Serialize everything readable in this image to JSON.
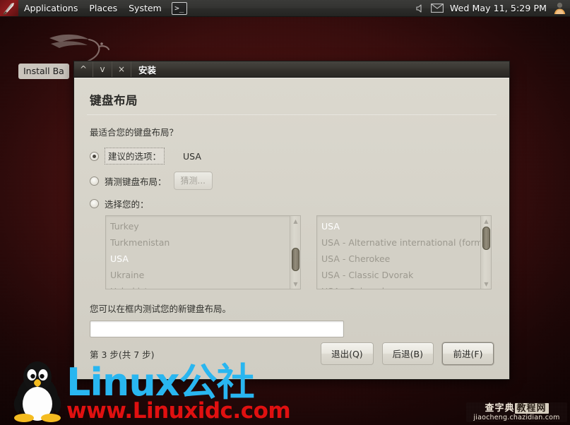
{
  "panel": {
    "logo_icon": "backtrack-sword-icon",
    "menus": [
      "Applications",
      "Places",
      "System"
    ],
    "terminal_icon": "terminal-icon",
    "terminal_glyph": ">_",
    "volume_icon": "volume-icon",
    "mail_icon": "mail-icon",
    "clock": "Wed May 11,  5:29 PM",
    "avatar_icon": "user-avatar-icon"
  },
  "desktop": {
    "icon_label": "Install Ba",
    "dragon_icon": "backtrack-dragon-logo"
  },
  "window": {
    "title": "安装",
    "buttons": {
      "shade": "^",
      "maximize": "v",
      "close": "×"
    },
    "heading": "键盘布局",
    "question": "最适合您的键盘布局？",
    "options": [
      {
        "label": "建议的选项：",
        "selected": true,
        "value": "USA"
      },
      {
        "label": "猜测键盘布局：",
        "selected": false,
        "button": "猜测..."
      },
      {
        "label": "选择您的：",
        "selected": false
      }
    ],
    "country_list": [
      {
        "name": "Turkey",
        "selected": false
      },
      {
        "name": "Turkmenistan",
        "selected": false
      },
      {
        "name": "USA",
        "selected": true
      },
      {
        "name": "Ukraine",
        "selected": false
      },
      {
        "name": "Uzbekistan",
        "selected": false
      }
    ],
    "variant_list": [
      {
        "name": "USA",
        "selected": true
      },
      {
        "name": "USA - Alternative international (forme",
        "selected": false
      },
      {
        "name": "USA - Cherokee",
        "selected": false
      },
      {
        "name": "USA - Classic Dvorak",
        "selected": false
      },
      {
        "name": "USA - Colemak",
        "selected": false
      }
    ],
    "test_hint": "您可以在框内测试您的新键盘布局。",
    "test_input_value": "",
    "step_text": "第 3 步(共 7 步)",
    "actions": [
      {
        "label": "退出(Q)",
        "focused": false
      },
      {
        "label": "后退(B)",
        "focused": false
      },
      {
        "label": "前进(F)",
        "focused": true
      }
    ]
  },
  "watermarks": {
    "linux_main": "Linux",
    "linux_cn": "公社",
    "linux_url": "www.Linuxidc.com",
    "chazidian_cn1": "查字典",
    "chazidian_cn2": "教程网",
    "chazidian_url": "jiaocheng.chazidian.com",
    "tux_icon": "tux-penguin-icon"
  }
}
